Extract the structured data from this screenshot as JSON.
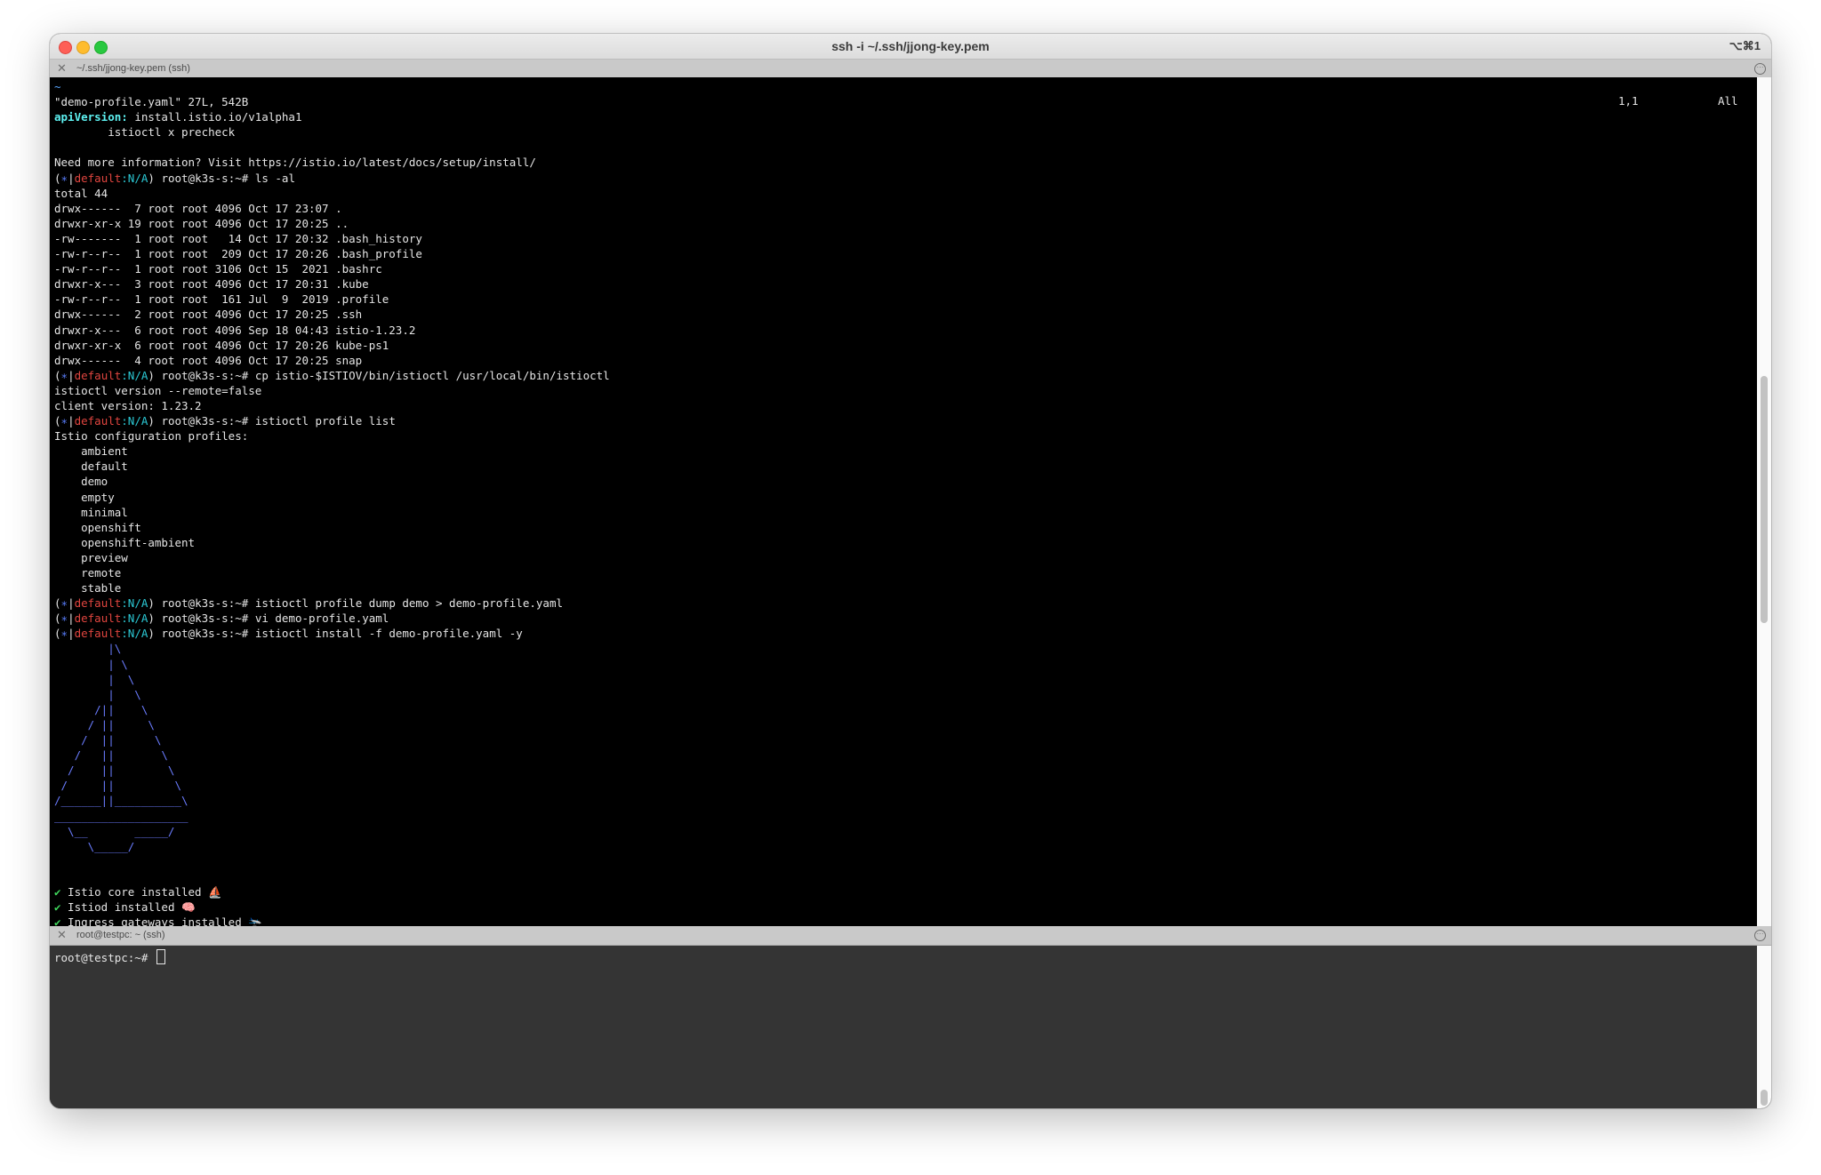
{
  "window": {
    "title": "ssh -i ~/.ssh/jjong-key.pem",
    "shortcut": "⌥⌘1",
    "pane1_title": "~/.ssh/jjong-key.pem (ssh)",
    "pane2_title": "root@testpc: ~ (ssh)"
  },
  "vim_status": {
    "position": "1,1",
    "scope": "All"
  },
  "prompt": {
    "star": "∗",
    "context": "default",
    "namespace": ":N/A",
    "host": " root@k3s-s:~# "
  },
  "pane1": {
    "tilde": "~",
    "file_info": "\"demo-profile.yaml\" 27L, 542B",
    "api_key": "apiVersion:",
    "api_value": " install.istio.io/v1alpha1",
    "precheck": "        istioctl x precheck",
    "blank1": "",
    "more_info": "Need more information? Visit https://istio.io/latest/docs/setup/install/",
    "cmd_ls": "ls -al",
    "ls_output": [
      "total 44",
      "drwx------  7 root root 4096 Oct 17 23:07 .",
      "drwxr-xr-x 19 root root 4096 Oct 17 20:25 ..",
      "-rw-------  1 root root   14 Oct 17 20:32 .bash_history",
      "-rw-r--r--  1 root root  209 Oct 17 20:26 .bash_profile",
      "-rw-r--r--  1 root root 3106 Oct 15  2021 .bashrc",
      "drwxr-x---  3 root root 4096 Oct 17 20:31 .kube",
      "-rw-r--r--  1 root root  161 Jul  9  2019 .profile",
      "drwx------  2 root root 4096 Oct 17 20:25 .ssh",
      "drwxr-x---  6 root root 4096 Sep 18 04:43 istio-1.23.2",
      "drwxr-xr-x  6 root root 4096 Oct 17 20:26 kube-ps1",
      "drwx------  4 root root 4096 Oct 17 20:25 snap"
    ],
    "cmd_cp": "cp istio-$ISTIOV/bin/istioctl /usr/local/bin/istioctl",
    "version_lines": [
      "istioctl version --remote=false",
      "client version: 1.23.2"
    ],
    "cmd_profile_list": "istioctl profile list",
    "profiles_header": "Istio configuration profiles:",
    "profiles": [
      "    ambient",
      "    default",
      "    demo",
      "    empty",
      "    minimal",
      "    openshift",
      "    openshift-ambient",
      "    preview",
      "    remote",
      "    stable"
    ],
    "cmd_dump": "istioctl profile dump demo > demo-profile.yaml",
    "cmd_vi": "vi demo-profile.yaml",
    "cmd_install": "istioctl install -f demo-profile.yaml -y",
    "ship_art": [
      "        |\\",
      "        | \\",
      "        |  \\",
      "        |   \\",
      "      /||    \\",
      "     / ||     \\",
      "    /  ||      \\",
      "   /   ||       \\",
      "  /    ||        \\",
      " /     ||         \\",
      "/______||__________\\",
      "____________________",
      "  \\__       _____/",
      "     \\_____/",
      "",
      ""
    ],
    "check": "✔",
    "installed": [
      {
        "text": " Istio core installed ",
        "emoji": "⛵️"
      },
      {
        "text": " Istiod installed ",
        "emoji": "🧠"
      },
      {
        "text": " Ingress gateways installed ",
        "emoji": "🛬"
      }
    ]
  },
  "pane2": {
    "prompt": "root@testpc:~# "
  }
}
